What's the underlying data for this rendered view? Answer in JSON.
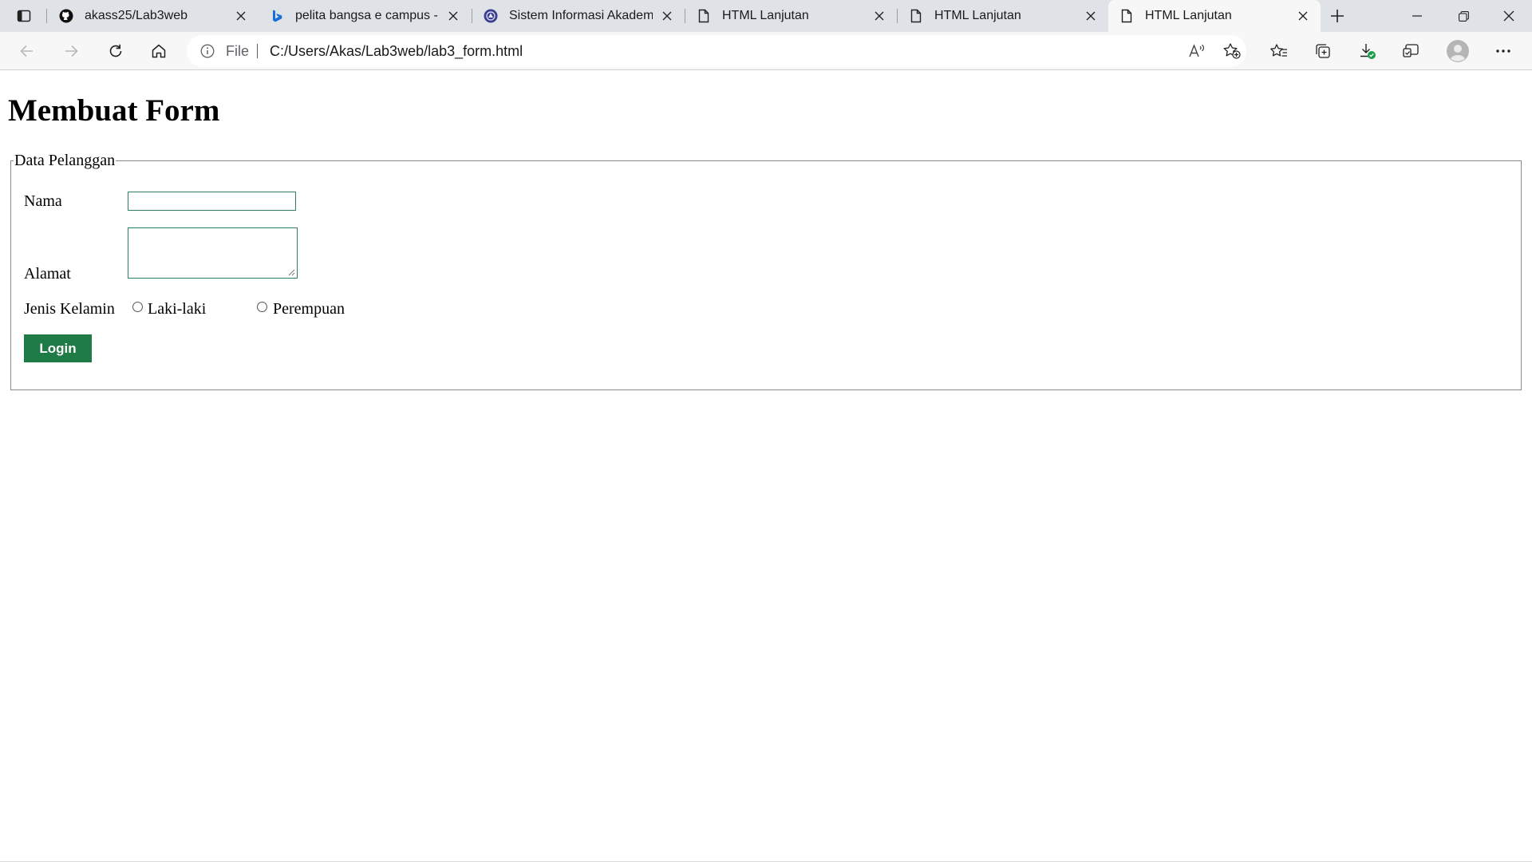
{
  "browser": {
    "tabs": [
      {
        "title": "akass25/Lab3web",
        "icon": "github-icon"
      },
      {
        "title": "pelita bangsa e campus - Ca",
        "icon": "bing-icon"
      },
      {
        "title": "Sistem Informasi Akademik",
        "icon": "university-logo-icon"
      },
      {
        "title": "HTML Lanjutan",
        "icon": "page-icon"
      },
      {
        "title": "HTML Lanjutan",
        "icon": "page-icon"
      },
      {
        "title": "HTML Lanjutan",
        "icon": "page-icon",
        "active": true
      }
    ],
    "address": {
      "scheme_label": "File",
      "url": "C:/Users/Akas/Lab3web/lab3_form.html"
    },
    "toolbar_icons": [
      "back-icon",
      "forward-icon",
      "refresh-icon",
      "home-icon",
      "read-aloud-icon",
      "add-favorite-icon",
      "favorites-icon",
      "collections-icon",
      "downloads-icon",
      "browser-essentials-icon",
      "profile-avatar",
      "more-icon"
    ],
    "window_controls": [
      "minimize-icon",
      "restore-icon",
      "close-icon"
    ],
    "accent_color": "#1e7b45"
  },
  "page": {
    "heading": "Membuat Form",
    "fieldset_legend": "Data Pelanggan",
    "form": {
      "nama_label": "Nama",
      "nama_value": "",
      "alamat_label": "Alamat",
      "alamat_value": "",
      "gender_label": "Jenis Kelamin",
      "gender_options": [
        "Laki-laki",
        "Perempuan"
      ],
      "gender_selected": null,
      "submit_label": "Login"
    }
  }
}
